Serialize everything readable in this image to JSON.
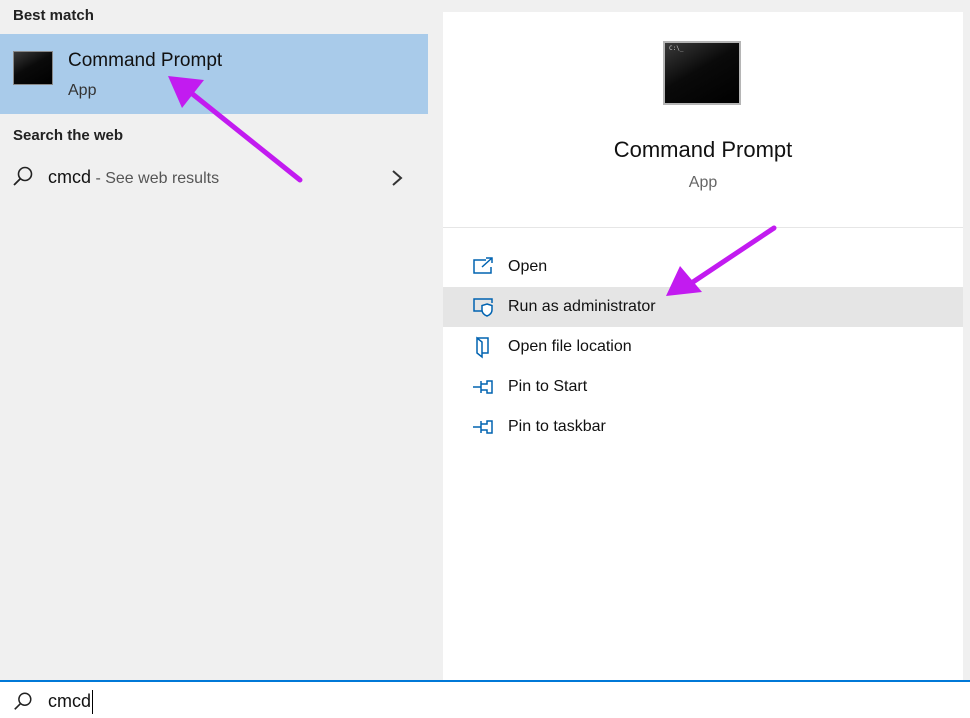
{
  "left_pane": {
    "best_match_title": "Best match",
    "best_match": {
      "name": "Command Prompt",
      "type": "App"
    },
    "search_web_title": "Search the web",
    "web_result": {
      "query": "cmcd",
      "suffix": " - See web results"
    }
  },
  "preview": {
    "name": "Command Prompt",
    "type": "App",
    "actions": [
      {
        "label": "Open",
        "icon": "open-icon"
      },
      {
        "label": "Run as administrator",
        "icon": "shield-icon"
      },
      {
        "label": "Open file location",
        "icon": "folder-icon"
      },
      {
        "label": "Pin to Start",
        "icon": "pin-icon"
      },
      {
        "label": "Pin to taskbar",
        "icon": "pin-icon"
      }
    ]
  },
  "search": {
    "value": "cmcd"
  },
  "colors": {
    "selection": "#a9cbea",
    "accent": "#0078d7",
    "annotation_arrow": "#c21bf0",
    "hover_row": "#e5e5e5"
  }
}
